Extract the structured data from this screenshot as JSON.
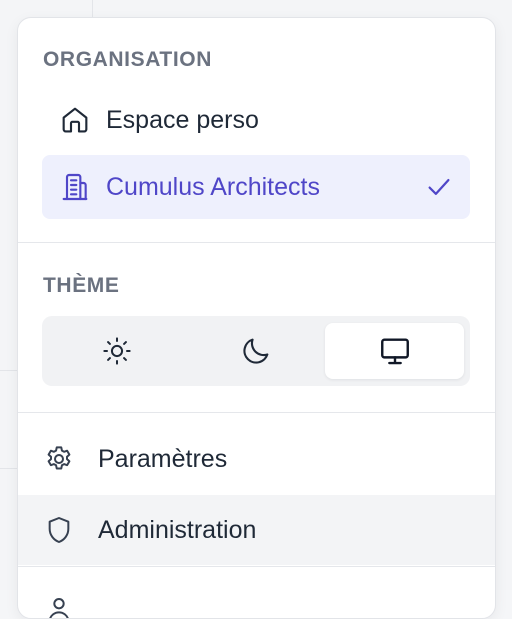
{
  "menu": {
    "organisation_heading": "ORGANISATION",
    "organisations": [
      {
        "label": "Espace perso",
        "icon": "home-icon",
        "selected": false
      },
      {
        "label": "Cumulus Architects",
        "icon": "building-icon",
        "selected": true
      }
    ],
    "theme_heading": "THÈME",
    "theme_options": [
      {
        "name": "light",
        "icon": "sun-icon",
        "active": false
      },
      {
        "name": "dark",
        "icon": "moon-icon",
        "active": false
      },
      {
        "name": "system",
        "icon": "monitor-icon",
        "active": true
      }
    ],
    "actions": [
      {
        "label": "Paramètres",
        "icon": "gear-icon"
      },
      {
        "label": "Administration",
        "icon": "shield-icon",
        "hovered": true
      }
    ]
  },
  "colors": {
    "accent": "#4f46c8",
    "selected_bg": "#eef0fd",
    "text": "#1f2937",
    "muted": "#6b7280"
  }
}
